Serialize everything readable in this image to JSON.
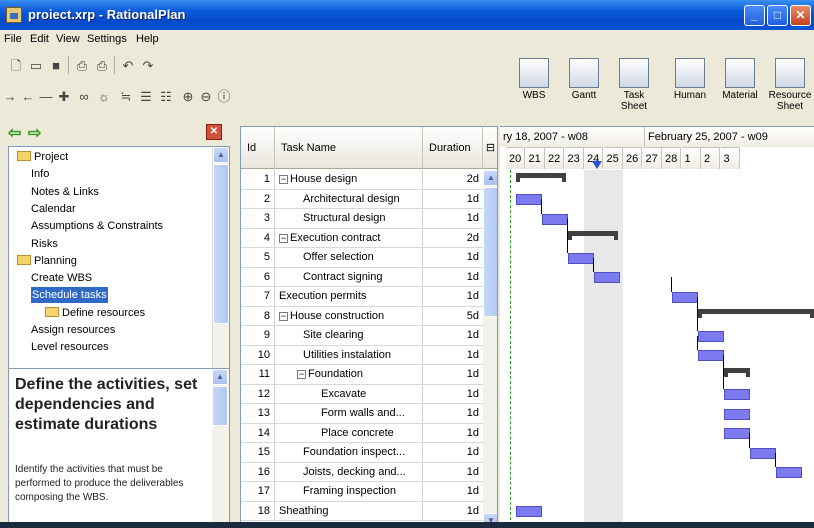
{
  "window": {
    "title": "proiect.xrp - RationalPlan"
  },
  "menu": [
    {
      "label": "File",
      "key": "F"
    },
    {
      "label": "Edit",
      "key": "E"
    },
    {
      "label": "View",
      "key": "V"
    },
    {
      "label": "Settings",
      "key": "S"
    },
    {
      "label": "Help",
      "key": "H"
    }
  ],
  "view_buttons": [
    {
      "label": "WBS",
      "icon": "wbs-icon"
    },
    {
      "label": "Gantt",
      "icon": "gantt-icon"
    },
    {
      "label": "Task Sheet",
      "icon": "task-sheet-icon"
    },
    {
      "label": "Human",
      "icon": "human-icon"
    },
    {
      "label": "Material",
      "icon": "material-icon"
    },
    {
      "label": "Resource Sheet",
      "icon": "resource-sheet-icon"
    }
  ],
  "tree": [
    {
      "label": "Project",
      "folder": true,
      "level": 0
    },
    {
      "label": "Info",
      "level": 1
    },
    {
      "label": "Notes & Links",
      "level": 1
    },
    {
      "label": "Calendar",
      "level": 1
    },
    {
      "label": "Assumptions & Constraints",
      "level": 1
    },
    {
      "label": "Risks",
      "level": 1
    },
    {
      "label": "Planning",
      "folder": true,
      "level": 0
    },
    {
      "label": "Create WBS",
      "level": 1
    },
    {
      "label": "Schedule tasks",
      "level": 1,
      "selected": true
    },
    {
      "label": "Define resources",
      "folder": true,
      "level": 2
    },
    {
      "label": "Assign resources",
      "level": 1
    },
    {
      "label": "Level resources",
      "level": 1
    }
  ],
  "help": {
    "title": "Define the activities, set dependencies and estimate durations",
    "body": "Identify the activities that must be performed to produce the deliverables composing the WBS."
  },
  "grid": {
    "headers": {
      "id": "Id",
      "name": "Task Name",
      "duration": "Duration"
    },
    "rows": [
      {
        "id": "1",
        "name": "House design",
        "dur": "2d",
        "level": 0,
        "toggle": "minus"
      },
      {
        "id": "2",
        "name": "Architectural design",
        "dur": "1d",
        "level": 1
      },
      {
        "id": "3",
        "name": "Structural design",
        "dur": "1d",
        "level": 1
      },
      {
        "id": "4",
        "name": "Execution contract",
        "dur": "2d",
        "level": 0,
        "toggle": "minus"
      },
      {
        "id": "5",
        "name": "Offer selection",
        "dur": "1d",
        "level": 1
      },
      {
        "id": "6",
        "name": "Contract signing",
        "dur": "1d",
        "level": 1
      },
      {
        "id": "7",
        "name": "Execution permits",
        "dur": "1d",
        "level": 0
      },
      {
        "id": "8",
        "name": "House construction",
        "dur": "5d",
        "level": 0,
        "toggle": "minus"
      },
      {
        "id": "9",
        "name": "Site clearing",
        "dur": "1d",
        "level": 1
      },
      {
        "id": "10",
        "name": "Utilities instalation",
        "dur": "1d",
        "level": 1
      },
      {
        "id": "11",
        "name": "Foundation",
        "dur": "1d",
        "level": 1,
        "toggle": "minus"
      },
      {
        "id": "12",
        "name": "Excavate",
        "dur": "1d",
        "level": 2
      },
      {
        "id": "13",
        "name": "Form walls and...",
        "dur": "1d",
        "level": 2
      },
      {
        "id": "14",
        "name": "Place concrete",
        "dur": "1d",
        "level": 2
      },
      {
        "id": "15",
        "name": "Foundation inspect...",
        "dur": "1d",
        "level": 1
      },
      {
        "id": "16",
        "name": "Joists, decking and...",
        "dur": "1d",
        "level": 1
      },
      {
        "id": "17",
        "name": "Framing inspection",
        "dur": "1d",
        "level": 1
      },
      {
        "id": "18",
        "name": "Sheathing",
        "dur": "1d",
        "level": 0
      }
    ]
  },
  "gantt": {
    "weeks": [
      "ry 18, 2007 - w08",
      "February 25, 2007 - w09"
    ],
    "days": [
      "20",
      "21",
      "22",
      "23",
      "24",
      "25",
      "26",
      "27",
      "28",
      "1",
      "2",
      "3"
    ],
    "colors": {
      "task": "#7b7bef",
      "summary": "#404040"
    }
  }
}
